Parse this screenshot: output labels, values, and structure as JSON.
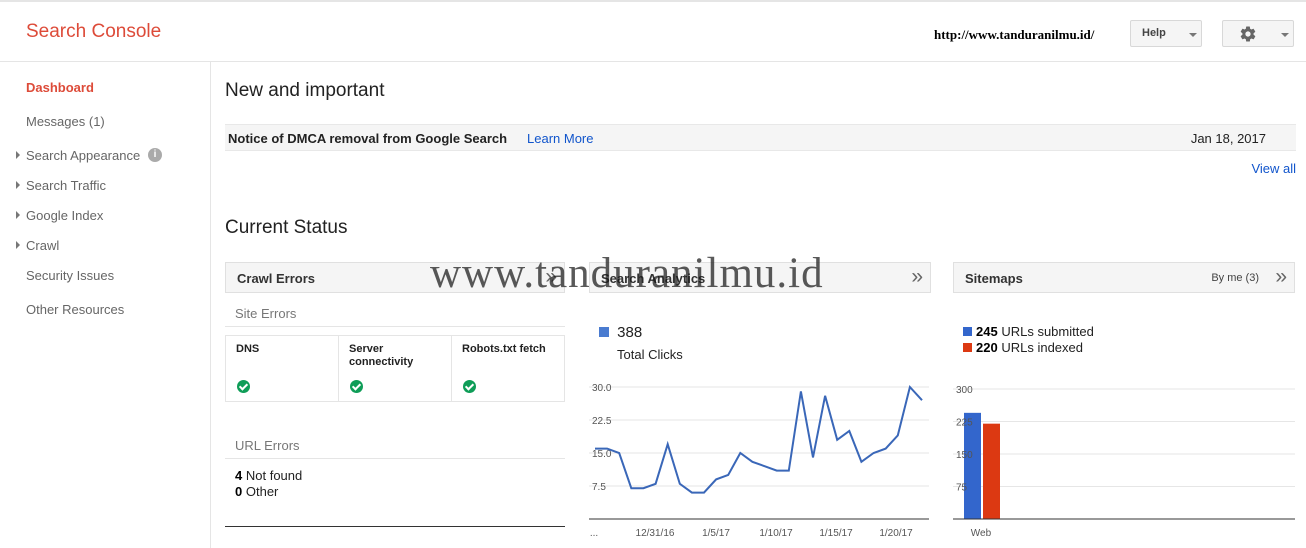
{
  "header": {
    "logo": "Search Console",
    "site_url": "http://www.tanduranilmu.id/",
    "help_label": "Help"
  },
  "sidebar": {
    "items": [
      {
        "label": "Dashboard"
      },
      {
        "label": "Messages (1)"
      },
      {
        "label": "Search Appearance"
      },
      {
        "label": "Search Traffic"
      },
      {
        "label": "Google Index"
      },
      {
        "label": "Crawl"
      },
      {
        "label": "Security Issues"
      },
      {
        "label": "Other Resources"
      }
    ],
    "info_glyph": "i"
  },
  "new_important": {
    "heading": "New and important",
    "notice_title": "Notice of DMCA removal from Google Search",
    "notice_link": "Learn More",
    "notice_date": "Jan 18, 2017",
    "view_all": "View all"
  },
  "current_status": {
    "heading": "Current Status",
    "more_glyph": "»",
    "crawl_errors": {
      "title": "Crawl Errors",
      "site_errors_label": "Site Errors",
      "cells": [
        {
          "label": "DNS",
          "status": "ok"
        },
        {
          "label": "Server connectivity",
          "status": "ok"
        },
        {
          "label": "Robots.txt fetch",
          "status": "ok"
        }
      ],
      "url_errors_label": "URL Errors",
      "not_found_count": "4",
      "not_found_label": "Not found",
      "other_count": "0",
      "other_label": "Other"
    },
    "search_analytics": {
      "title": "Search Analytics",
      "total_value": "388",
      "total_label": "Total Clicks",
      "color": "#4a7bd0"
    },
    "sitemaps": {
      "title": "Sitemaps",
      "filter_label": "By me (3)",
      "submitted_count": "245",
      "submitted_label": "URLs submitted",
      "indexed_count": "220",
      "indexed_label": "URLs indexed",
      "submitted_color": "#3366cc",
      "indexed_color": "#dc3912"
    }
  },
  "watermark": "www.tanduranilmu.id",
  "chart_data": [
    {
      "type": "line",
      "title": "",
      "series": [
        {
          "name": "Total Clicks",
          "values": [
            16,
            16,
            15,
            7,
            7,
            8,
            17,
            8,
            6,
            6,
            9,
            10,
            15,
            13,
            12,
            11,
            11,
            29,
            14,
            28,
            18,
            20,
            13,
            15,
            16,
            19,
            30,
            27
          ]
        }
      ],
      "x_tick_labels": [
        "...",
        "12/31/16",
        "1/5/17",
        "1/10/17",
        "1/15/17",
        "1/20/17"
      ],
      "y_tick_labels": [
        "30.0",
        "22.5",
        "15.0",
        "7.5"
      ],
      "ylim": [
        0,
        30
      ],
      "grid": true
    },
    {
      "type": "bar",
      "title": "",
      "categories": [
        "Web"
      ],
      "series": [
        {
          "name": "URLs submitted",
          "values": [
            245
          ]
        },
        {
          "name": "URLs indexed",
          "values": [
            220
          ]
        }
      ],
      "y_tick_labels": [
        "300",
        "225",
        "150",
        "75"
      ],
      "ylim": [
        0,
        300
      ],
      "grid": true
    }
  ]
}
